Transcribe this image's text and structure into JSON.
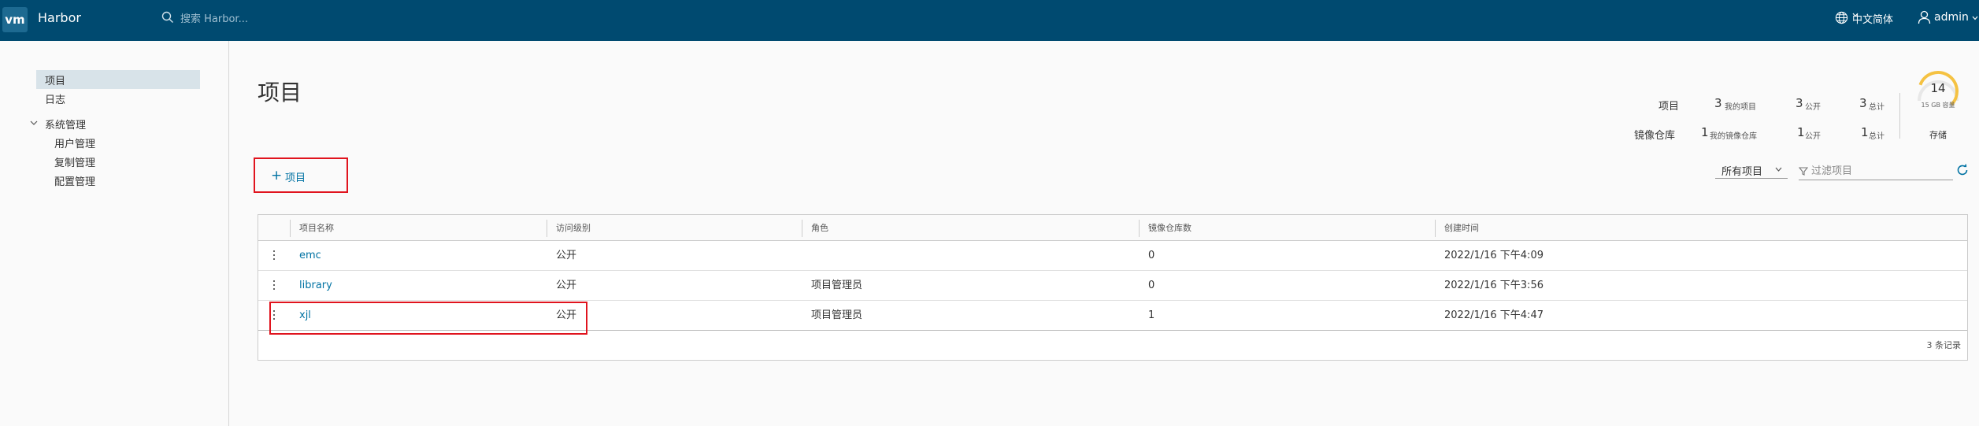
{
  "header": {
    "logo_text": "vm",
    "app_title": "Harbor",
    "search_placeholder": "搜索 Harbor...",
    "language": "中文简体",
    "user": "admin",
    "background": "#004a70"
  },
  "sidebar": {
    "items": [
      {
        "label": "项目",
        "active": true
      },
      {
        "label": "日志"
      },
      {
        "label": "系统管理",
        "expanded": true
      },
      {
        "label": "用户管理"
      },
      {
        "label": "复制管理"
      },
      {
        "label": "配置管理"
      }
    ]
  },
  "main": {
    "title": "项目",
    "stats": {
      "projects_label": "项目",
      "repos_label": "镜像仓库",
      "projects": {
        "mine": "3",
        "mine_label": "我的项目",
        "public": "3",
        "public_label": "公开",
        "total": "3",
        "total_label": "总计"
      },
      "repos": {
        "mine": "1",
        "mine_label": "我的镜像仓库",
        "public": "1",
        "public_label": "公开",
        "total": "1",
        "total_label": "总计"
      }
    },
    "storage": {
      "value": "14",
      "capacity": "15 GB 容量",
      "label": "存储",
      "used_fraction": 0.93
    },
    "new_project_button": "项目",
    "filter": {
      "select_value": "所有项目",
      "placeholder": "过滤项目"
    },
    "table": {
      "columns": [
        "项目名称",
        "访问级别",
        "角色",
        "镜像仓库数",
        "创建时间"
      ],
      "rows": [
        {
          "name": "emc",
          "access": "公开",
          "role": "",
          "repos": "0",
          "created": "2022/1/16 下午4:09"
        },
        {
          "name": "library",
          "access": "公开",
          "role": "项目管理员",
          "repos": "0",
          "created": "2022/1/16 下午3:56"
        },
        {
          "name": "xjl",
          "access": "公开",
          "role": "项目管理员",
          "repos": "1",
          "created": "2022/1/16 下午4:47"
        }
      ],
      "footer": "3 条记录"
    }
  },
  "colors": {
    "accent": "#0072a3",
    "highlight": "#e0141e",
    "gauge": "#f5c242"
  }
}
